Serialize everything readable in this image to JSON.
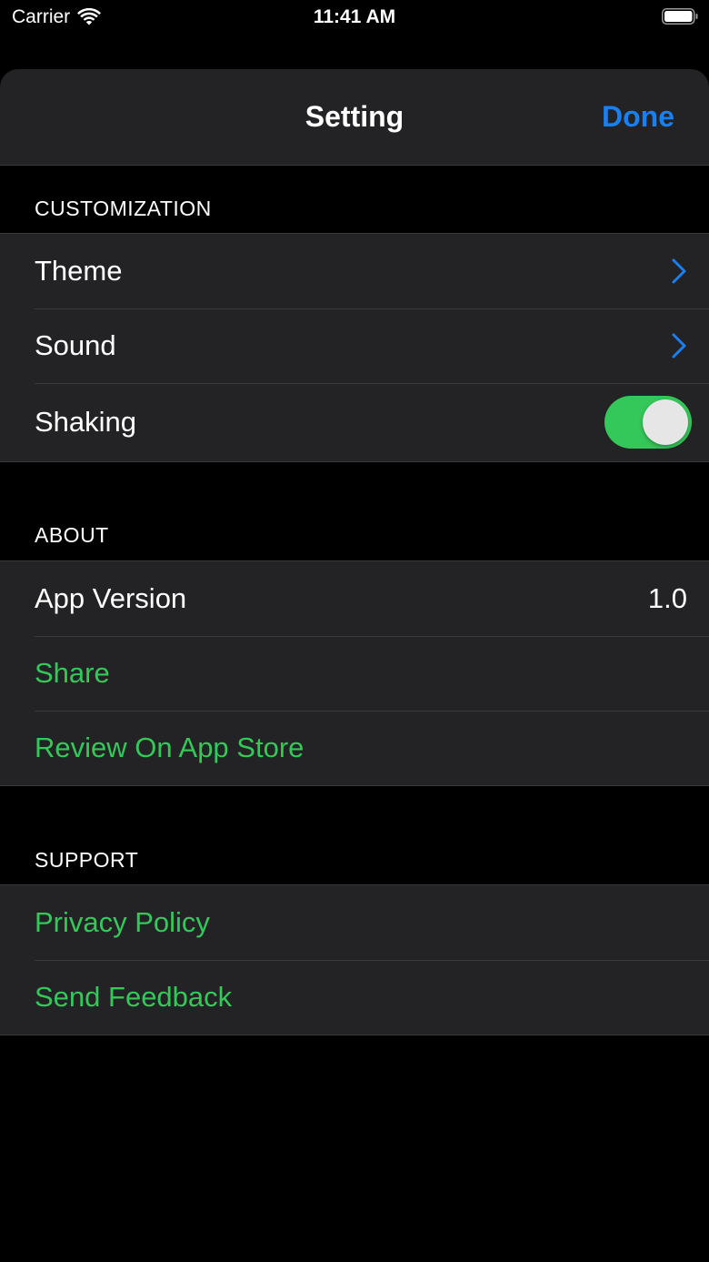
{
  "status_bar": {
    "carrier": "Carrier",
    "time": "11:41 AM",
    "icons": [
      "wifi-icon",
      "battery-icon"
    ]
  },
  "nav": {
    "title": "Setting",
    "done_label": "Done"
  },
  "sections": {
    "customization": {
      "header": "CUSTOMIZATION",
      "theme_label": "Theme",
      "sound_label": "Sound",
      "shaking_label": "Shaking",
      "shaking_on": true
    },
    "about": {
      "header": "ABOUT",
      "app_version_label": "App Version",
      "app_version_value": "1.0",
      "share_label": "Share",
      "review_label": "Review On App Store"
    },
    "support": {
      "header": "SUPPORT",
      "privacy_label": "Privacy Policy",
      "feedback_label": "Send Feedback"
    }
  },
  "colors": {
    "accent_blue": "#1a7ff0",
    "action_green": "#34c759",
    "cell_background": "#232325",
    "page_background": "#000000"
  }
}
